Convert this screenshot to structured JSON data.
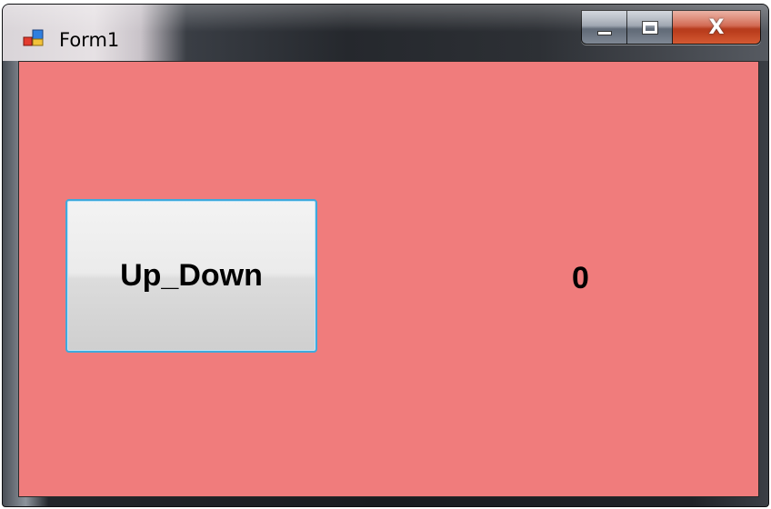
{
  "window": {
    "title": "Form1",
    "icon": "windows-form-icon",
    "caption_buttons": {
      "minimize_icon": "minimize-icon",
      "maximize_icon": "maximize-icon",
      "close_label": "X"
    }
  },
  "form": {
    "background_color": "#f07c7c",
    "button_label": "Up_Down",
    "counter_value": "0"
  }
}
